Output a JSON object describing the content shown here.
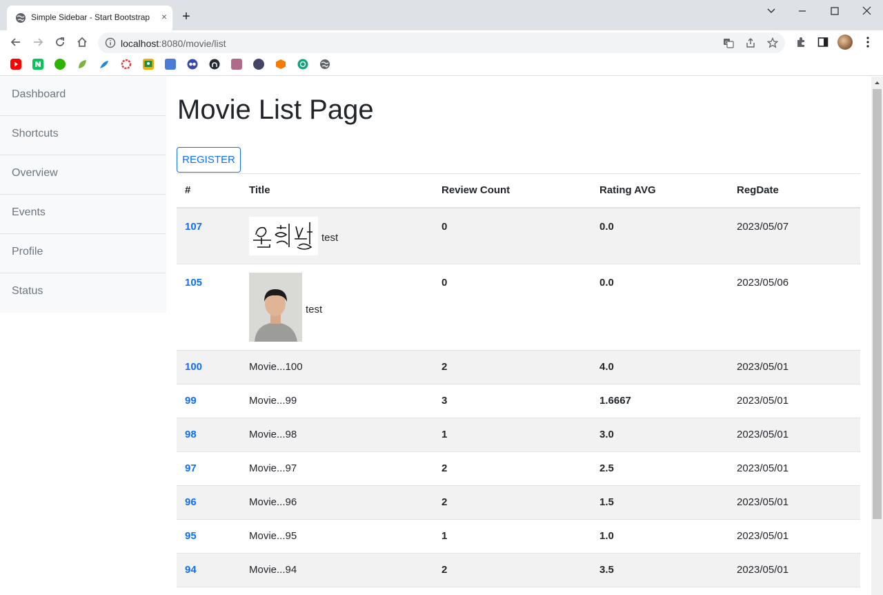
{
  "browser": {
    "tab_title": "Simple Sidebar - Start Bootstrap",
    "url_host": "localhost",
    "url_rest": ":8080/movie/list",
    "new_tab": "+",
    "tab_close": "×"
  },
  "sidebar": {
    "items": [
      {
        "label": "Dashboard"
      },
      {
        "label": "Shortcuts"
      },
      {
        "label": "Overview"
      },
      {
        "label": "Events"
      },
      {
        "label": "Profile"
      },
      {
        "label": "Status"
      }
    ]
  },
  "main": {
    "title": "Movie List Page",
    "register_label": "REGISTER",
    "columns": [
      "#",
      "Title",
      "Review Count",
      "Rating AVG",
      "RegDate"
    ],
    "rows": [
      {
        "num": "107",
        "title": "test",
        "thumb": "signature",
        "review_count": "0",
        "rating_avg": "0.0",
        "reg_date": "2023/05/07"
      },
      {
        "num": "105",
        "title": "test",
        "thumb": "photo",
        "review_count": "0",
        "rating_avg": "0.0",
        "reg_date": "2023/05/06"
      },
      {
        "num": "100",
        "title": "Movie...100",
        "thumb": "",
        "review_count": "2",
        "rating_avg": "4.0",
        "reg_date": "2023/05/01"
      },
      {
        "num": "99",
        "title": "Movie...99",
        "thumb": "",
        "review_count": "3",
        "rating_avg": "1.6667",
        "reg_date": "2023/05/01"
      },
      {
        "num": "98",
        "title": "Movie...98",
        "thumb": "",
        "review_count": "1",
        "rating_avg": "3.0",
        "reg_date": "2023/05/01"
      },
      {
        "num": "97",
        "title": "Movie...97",
        "thumb": "",
        "review_count": "2",
        "rating_avg": "2.5",
        "reg_date": "2023/05/01"
      },
      {
        "num": "96",
        "title": "Movie...96",
        "thumb": "",
        "review_count": "2",
        "rating_avg": "1.5",
        "reg_date": "2023/05/01"
      },
      {
        "num": "95",
        "title": "Movie...95",
        "thumb": "",
        "review_count": "1",
        "rating_avg": "1.0",
        "reg_date": "2023/05/01"
      },
      {
        "num": "94",
        "title": "Movie...94",
        "thumb": "",
        "review_count": "2",
        "rating_avg": "3.5",
        "reg_date": "2023/05/01"
      }
    ]
  },
  "bookmarks": [
    {
      "icon": "youtube-icon",
      "color": "#ff0000"
    },
    {
      "icon": "naver-icon",
      "color": "#03c75a"
    },
    {
      "icon": "bookmark-green-icon",
      "color": "#2db400"
    },
    {
      "icon": "leaf-icon",
      "color": "#7cb342"
    },
    {
      "icon": "feather-icon",
      "color": "#1e88e5"
    },
    {
      "icon": "ring-icon",
      "color": "#e53935"
    },
    {
      "icon": "classroom-icon",
      "color": "#f9ab00"
    },
    {
      "icon": "grid-icon",
      "color": "#4a7bd8"
    },
    {
      "icon": "owl-icon",
      "color": "#3949ab"
    },
    {
      "icon": "github-icon",
      "color": "#24292f"
    },
    {
      "icon": "photo-bookmark-icon",
      "color": "#b06a8a"
    },
    {
      "icon": "avatar-bookmark-icon",
      "color": "#444466"
    },
    {
      "icon": "box-icon",
      "color": "#f57c00"
    },
    {
      "icon": "chatgpt-icon",
      "color": "#10a37f"
    },
    {
      "icon": "globe-icon",
      "color": "#5f6368"
    }
  ],
  "colors": {
    "accent": "#0d6efd",
    "striped_row": "#f2f2f2",
    "sidebar_bg": "#f8f9fa"
  }
}
